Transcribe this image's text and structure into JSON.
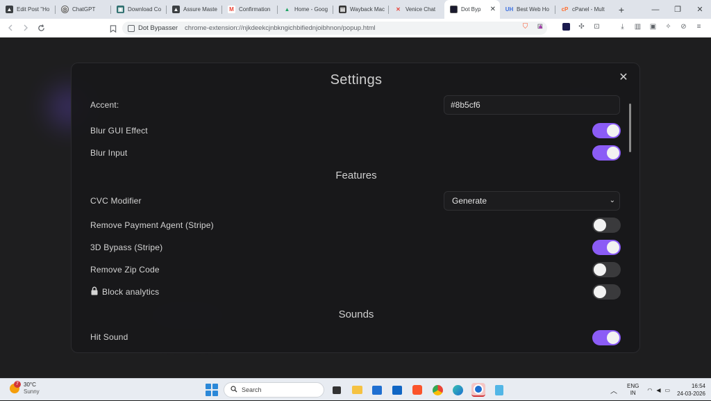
{
  "browser": {
    "tabs": [
      {
        "title": "Edit Post \"Ho",
        "icon": "wordpress-icon",
        "color": "#3c4043"
      },
      {
        "title": "ChatGPT",
        "icon": "chatgpt-icon",
        "color": "#3c4043"
      },
      {
        "title": "Download Co",
        "icon": "download-icon",
        "color": "#2f6f6f"
      },
      {
        "title": "Assure Maste",
        "icon": "assure-icon",
        "color": "#3c4043"
      },
      {
        "title": "Confirmation",
        "icon": "gmail-icon",
        "color": "#ea4335"
      },
      {
        "title": "Home - Goog",
        "icon": "google-drive-icon",
        "color": "#1fa463"
      },
      {
        "title": "Wayback Mac",
        "icon": "wayback-icon",
        "color": "#333333"
      },
      {
        "title": "Venice Chat",
        "icon": "venice-icon",
        "color": "#e8453c"
      },
      {
        "title": "Dot Byp",
        "icon": "dot-bypasser-icon",
        "color": "#1a1a2e",
        "active": true
      },
      {
        "title": "Best Web Ho",
        "icon": "uh-icon",
        "color": "#3b6fe0"
      },
      {
        "title": "cPanel - Mult",
        "icon": "cpanel-icon",
        "color": "#ff6c2c"
      }
    ],
    "new_tab_label": "+",
    "omnibox": {
      "chip_label": "Dot Bypasser",
      "url": "chrome-extension://njkdeekcjnbkngichbifiednjoibhnon/popup.html"
    }
  },
  "modal": {
    "title": "Settings",
    "close_label": "✕",
    "accent": {
      "label": "Accent:",
      "value": "#8b5cf6"
    },
    "blur_gui": {
      "label": "Blur GUI Effect",
      "on": true
    },
    "blur_input": {
      "label": "Blur Input",
      "on": true
    },
    "features_title": "Features",
    "cvc_modifier": {
      "label": "CVC Modifier",
      "selected": "Generate"
    },
    "remove_payment_agent": {
      "label": "Remove Payment Agent (Stripe)",
      "on": false
    },
    "bypass_3d": {
      "label": "3D Bypass (Stripe)",
      "on": true
    },
    "remove_zip": {
      "label": "Remove Zip Code",
      "on": false
    },
    "block_analytics": {
      "label": "Block analytics",
      "on": false,
      "locked": true
    },
    "sounds_title": "Sounds",
    "hit_sound": {
      "label": "Hit Sound",
      "on": true
    }
  },
  "taskbar": {
    "weather": {
      "temp": "30°C",
      "condition": "Sunny",
      "badge": "7"
    },
    "search_placeholder": "Search",
    "lang": {
      "line1": "ENG",
      "line2": "IN"
    },
    "clock": {
      "time": "16:54",
      "date": "24-03-2026"
    }
  },
  "colors": {
    "accent": "#8b5cf6",
    "toggle_off": "#3a3a3c",
    "modal_bg": "#18181a"
  }
}
